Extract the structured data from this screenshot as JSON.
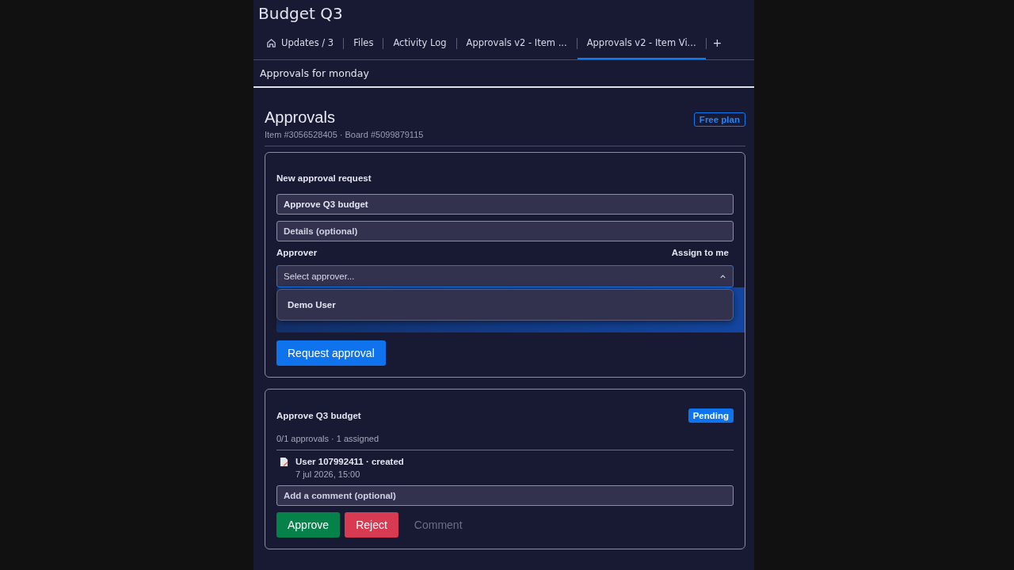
{
  "board": {
    "title": "Budget Q3"
  },
  "tabs": [
    {
      "label": "Updates / 3",
      "kind": "home",
      "selected": false
    },
    {
      "label": "Files",
      "kind": "plain",
      "selected": false
    },
    {
      "label": "Activity Log",
      "kind": "plain",
      "selected": false
    },
    {
      "label": "Approvals v2 - Item ...",
      "kind": "plain",
      "selected": false
    },
    {
      "label": "Approvals v2 - Item Vi...",
      "kind": "plain",
      "selected": true
    }
  ],
  "add_tab": "+",
  "view_title": "Approvals for monday",
  "header": {
    "title": "Approvals",
    "subtitle": "Item #3056528405 · Board #5099879115",
    "plan_badge": "Free plan"
  },
  "new_request": {
    "heading": "New approval request",
    "title_value": "Approve Q3 budget",
    "details_placeholder": "Details (optional)",
    "approver_label": "Approver",
    "assign_link": "Assign to me",
    "select_placeholder": "Select approver...",
    "select_expanded": true,
    "options": [
      "Demo User"
    ],
    "submit": "Request approval"
  },
  "request": {
    "title": "Approve Q3 budget",
    "status": "Pending",
    "summary": "0/1 approvals · 1 assigned",
    "activity": [
      {
        "text": "User 107992411 · created",
        "time": "7 jul 2026, 15:00"
      }
    ],
    "comment_placeholder": "Add a comment (optional)",
    "buttons": [
      {
        "label": "Approve",
        "kind": "approve",
        "disabled": false
      },
      {
        "label": "Reject",
        "kind": "reject",
        "disabled": false
      },
      {
        "label": "Comment",
        "kind": "comment",
        "disabled": true
      }
    ]
  }
}
